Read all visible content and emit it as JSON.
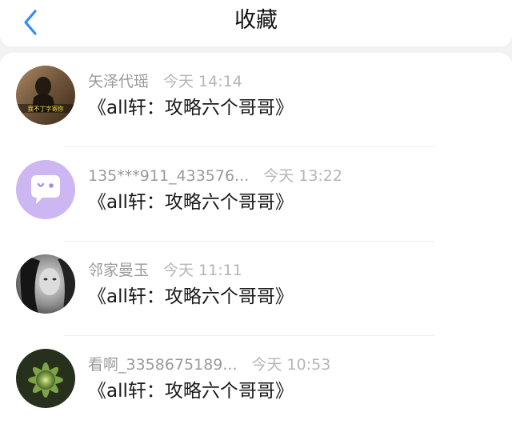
{
  "header": {
    "title": "收藏",
    "back_icon": "chevron-left-icon",
    "accent_color": "#2f8ff0"
  },
  "favorites": [
    {
      "user": "矢泽代瑶",
      "time": "今天 14:14",
      "text": "《all轩：攻略六个哥哥》",
      "avatar_caption": "我不丁字寄你"
    },
    {
      "user": "135***911_433576...",
      "time": "今天 13:22",
      "text": "《all轩：攻略六个哥哥》",
      "avatar_icon": "chat-bubble-icon",
      "avatar_color": "#cdb7f2"
    },
    {
      "user": "邻家曼玉",
      "time": "今天 11:11",
      "text": "《all轩：攻略六个哥哥》"
    },
    {
      "user": "看啊_3358675189...",
      "time": "今天 10:53",
      "text": "《all轩：攻略六个哥哥》"
    }
  ]
}
